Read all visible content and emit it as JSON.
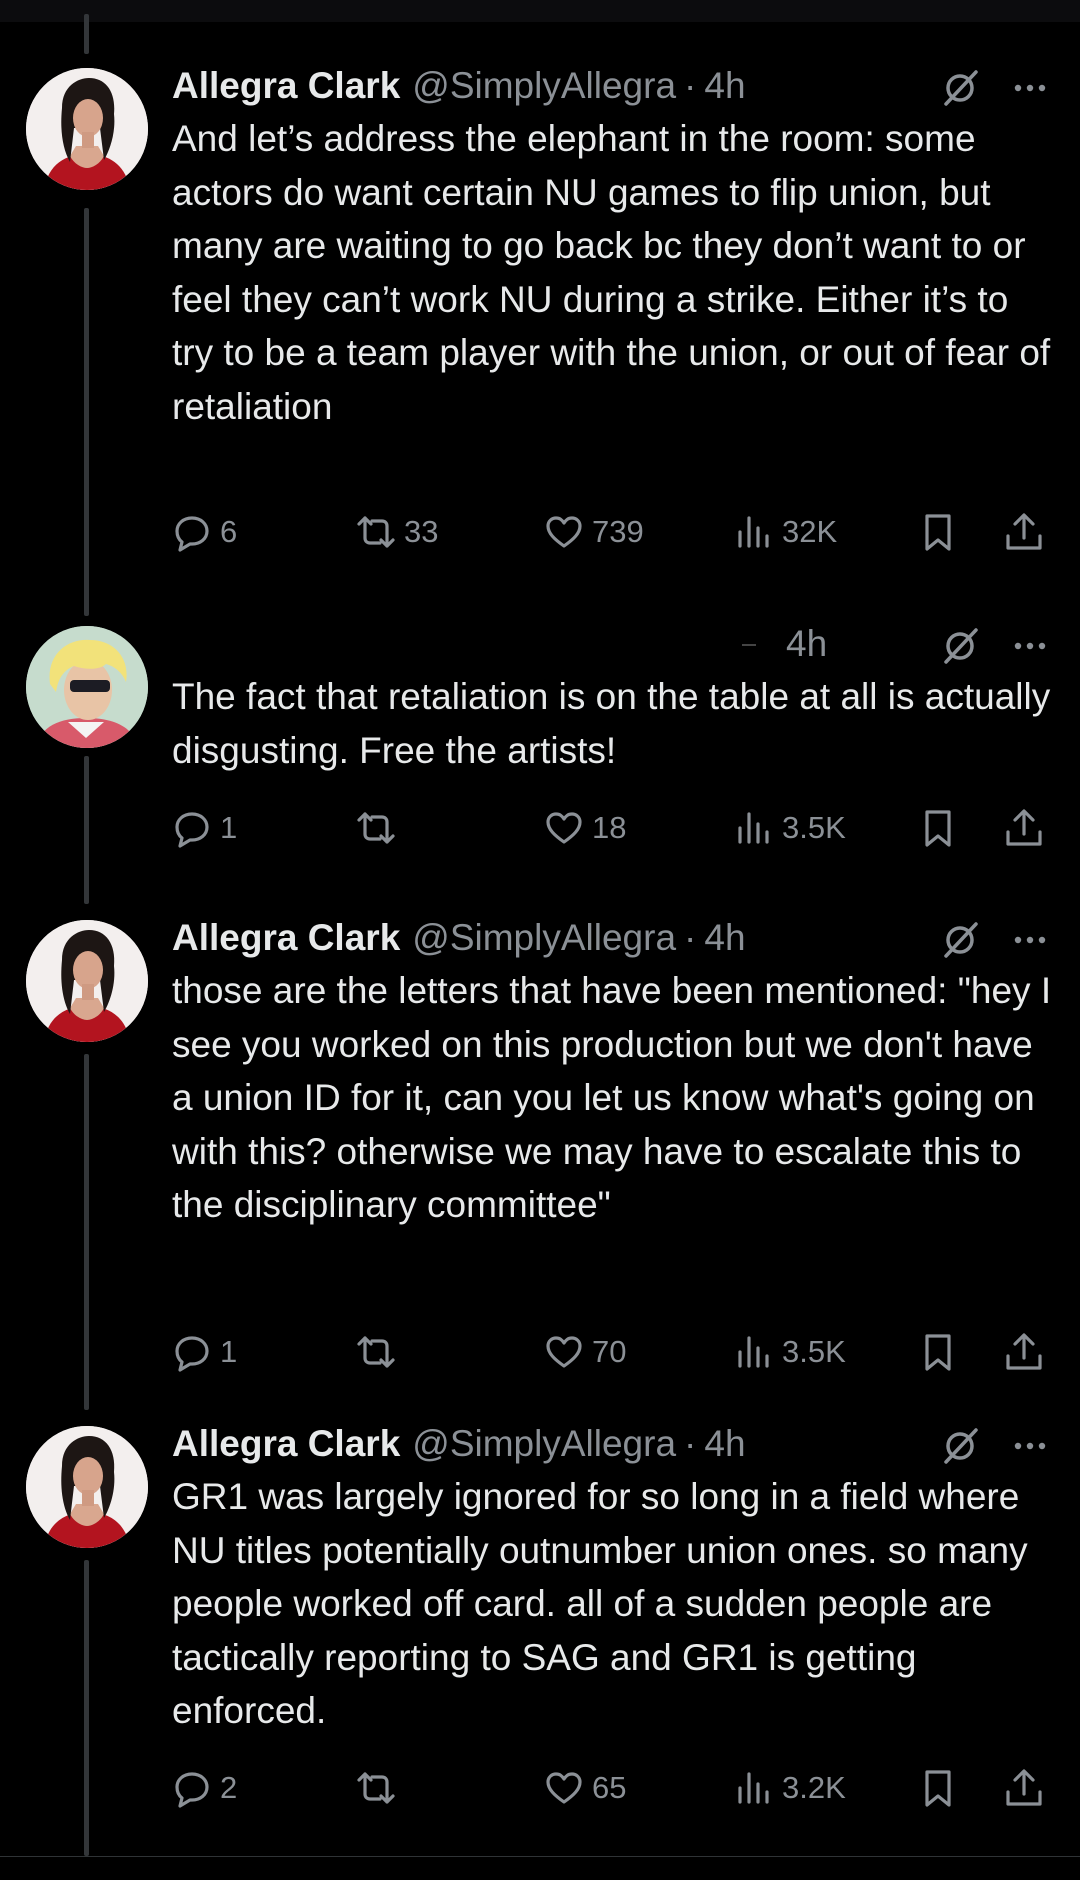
{
  "tweets": [
    {
      "author": "Allegra Clark",
      "handle": "@SimplyAllegra",
      "separator": "·",
      "time": "4h",
      "text": "And let’s address the elephant in the room: some actors do want certain NU games to flip union, but many are waiting to go back bc they don’t want to or feel they can’t work NU during a strike. Either it’s to try to be a team player with the union, or out of fear of retaliation",
      "replies": "6",
      "reposts": "33",
      "likes": "739",
      "views": "32K"
    },
    {
      "author": "",
      "handle": "",
      "separator": "",
      "time": "4h",
      "text": "The fact that retaliation is on the table at all is actually disgusting. Free the artists!",
      "replies": "1",
      "reposts": "",
      "likes": "18",
      "views": "3.5K"
    },
    {
      "author": "Allegra Clark",
      "handle": "@SimplyAllegra",
      "separator": "·",
      "time": "4h",
      "text": "those are the letters that have been mentioned: \"hey I see you worked on this production but we don't have a union ID for it, can you let us know what's going on with this? otherwise we may have to escalate this to the disciplinary committee\"",
      "replies": "1",
      "reposts": "",
      "likes": "70",
      "views": "3.5K"
    },
    {
      "author": "Allegra Clark",
      "handle": "@SimplyAllegra",
      "separator": "·",
      "time": "4h",
      "text": "GR1 was largely ignored for so long in a field where NU titles potentially outnumber union ones. so many people worked off card. all of a sudden people are tactically reporting to SAG and GR1 is getting enforced.",
      "replies": "2",
      "reposts": "",
      "likes": "65",
      "views": "3.2K"
    }
  ],
  "icons": {
    "reply": "reply-icon",
    "repost": "repost-icon",
    "like": "like-icon",
    "views": "views-icon",
    "bookmark": "bookmark-icon",
    "share": "share-icon",
    "grok": "grok-icon",
    "more": "more-icon"
  },
  "colors": {
    "background": "#000000",
    "text": "#e7e9ea",
    "muted": "#8b9096",
    "thread_line": "#333639",
    "avatar_dress": "#b3141f"
  }
}
